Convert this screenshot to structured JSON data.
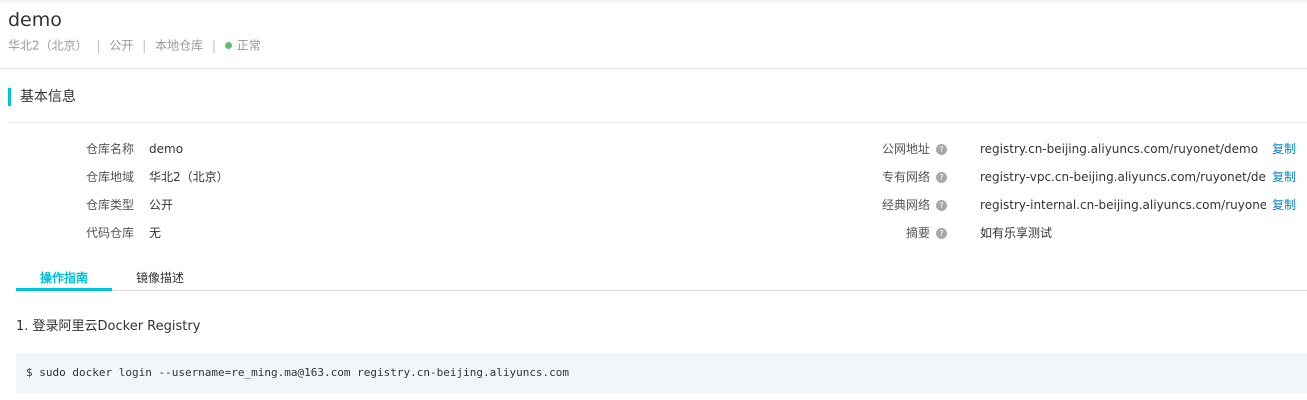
{
  "header": {
    "title": "demo",
    "region": "华北2（北京）",
    "separator": "|",
    "visibility": "公开",
    "repo_source": "本地仓库",
    "status": "正常",
    "status_color": "#5ec26a"
  },
  "section": {
    "title": "基本信息",
    "accent_color": "#00c1de"
  },
  "left_info": [
    {
      "label": "仓库名称",
      "value": "demo"
    },
    {
      "label": "仓库地域",
      "value": "华北2（北京）"
    },
    {
      "label": "仓库类型",
      "value": "公开"
    },
    {
      "label": "代码仓库",
      "value": "无"
    }
  ],
  "right_info": [
    {
      "label": "公网地址",
      "value": "registry.cn-beijing.aliyuncs.com/ruyonet/demo",
      "action": "复制"
    },
    {
      "label": "专有网络",
      "value": "registry-vpc.cn-beijing.aliyuncs.com/ruyonet/demo",
      "action": "复制"
    },
    {
      "label": "经典网络",
      "value": "registry-internal.cn-beijing.aliyuncs.com/ruyonet/demo",
      "action": "复制"
    },
    {
      "label": "摘要",
      "value": "如有乐享测试",
      "action": ""
    }
  ],
  "help_icon_glyph": "?",
  "tabs": [
    {
      "label": "操作指南",
      "active": true
    },
    {
      "label": "镜像描述",
      "active": false
    }
  ],
  "guide": {
    "step1_title": "1. 登录阿里云Docker Registry",
    "step1_command": "$ sudo docker login --username=re_ming.ma@163.com registry.cn-beijing.aliyuncs.com"
  },
  "colors": {
    "link": "#0a86d1",
    "code_bg": "#f2f6fb"
  }
}
